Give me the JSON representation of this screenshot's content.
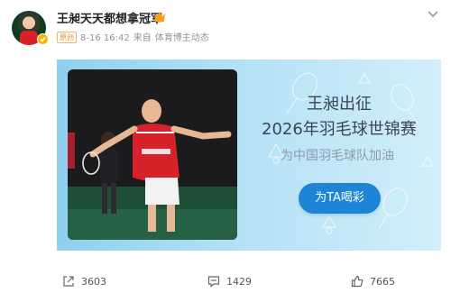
{
  "post": {
    "author_name": "王昶天天都想拿冠军",
    "badge_tag": "原创",
    "time": "8-16 16:42",
    "source_prefix": "来自",
    "source": "体育博主动态"
  },
  "banner": {
    "headline_line1": "王昶出征",
    "headline_line2": "2026年羽毛球世锦赛",
    "subline": "为中国羽毛球队加油",
    "cheer_button": "为TA喝彩"
  },
  "actions": {
    "repost_count": "3603",
    "comment_count": "1429",
    "like_count": "7665"
  },
  "colors": {
    "accent": "#1e84d8",
    "banner_bg": "#b5e2f6",
    "verified": "#f6b400"
  },
  "icons": [
    "avatar",
    "verified-badge-icon",
    "crown-icon",
    "chevron-down-icon",
    "repost-icon",
    "comment-icon",
    "like-icon"
  ]
}
